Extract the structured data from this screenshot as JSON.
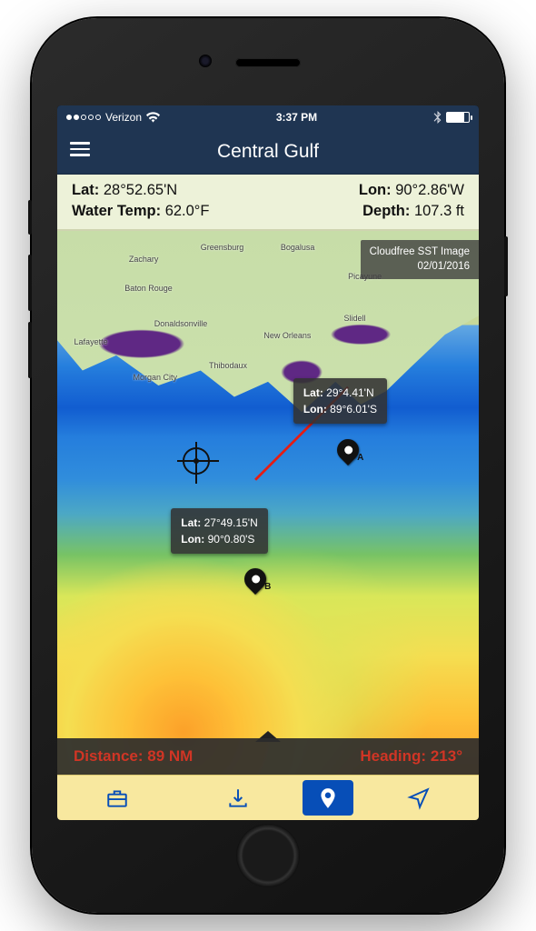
{
  "status_bar": {
    "carrier": "Verizon",
    "time": "3:37 PM"
  },
  "nav": {
    "title": "Central Gulf"
  },
  "info": {
    "lat_label": "Lat:",
    "lat_value": "28°52.65'N",
    "lon_label": "Lon:",
    "lon_value": "90°2.86'W",
    "temp_label": "Water Temp:",
    "temp_value": "62.0°F",
    "depth_label": "Depth:",
    "depth_value": "107.3 ft"
  },
  "overlay": {
    "title": "Cloudfree SST Image",
    "date": "02/01/2016"
  },
  "markers": {
    "a": {
      "label": "A",
      "lat_label": "Lat:",
      "lat_value": "29°4.41'N",
      "lon_label": "Lon:",
      "lon_value": "89°6.01'S"
    },
    "b": {
      "label": "B",
      "lat_label": "Lat:",
      "lat_value": "27°49.15'N",
      "lon_label": "Lon:",
      "lon_value": "90°0.80'S"
    }
  },
  "measure": {
    "distance_label": "Distance:",
    "distance_value": "89 NM",
    "heading_label": "Heading:",
    "heading_value": "213°"
  },
  "cities": {
    "baton_rouge": "Baton Rouge",
    "new_orleans": "New Orleans",
    "lafayette": "Lafayette",
    "morgan_city": "Morgan City",
    "donaldsonville": "Donaldsonville",
    "thibodaux": "Thibodaux",
    "zachary": "Zachary",
    "greensburg": "Greensburg",
    "bogalusa": "Bogalusa",
    "picayune": "Picayune",
    "slidell": "Slidell"
  },
  "toolbar": {
    "toolbox": "toolbox",
    "download": "download",
    "marker": "marker",
    "locate": "locate",
    "active": "marker"
  },
  "colors": {
    "navy": "#1f3552",
    "cream": "#edf2d9",
    "red": "#c0392b",
    "brand_blue": "#0f4da8",
    "yellow": "#f6e8a8"
  }
}
